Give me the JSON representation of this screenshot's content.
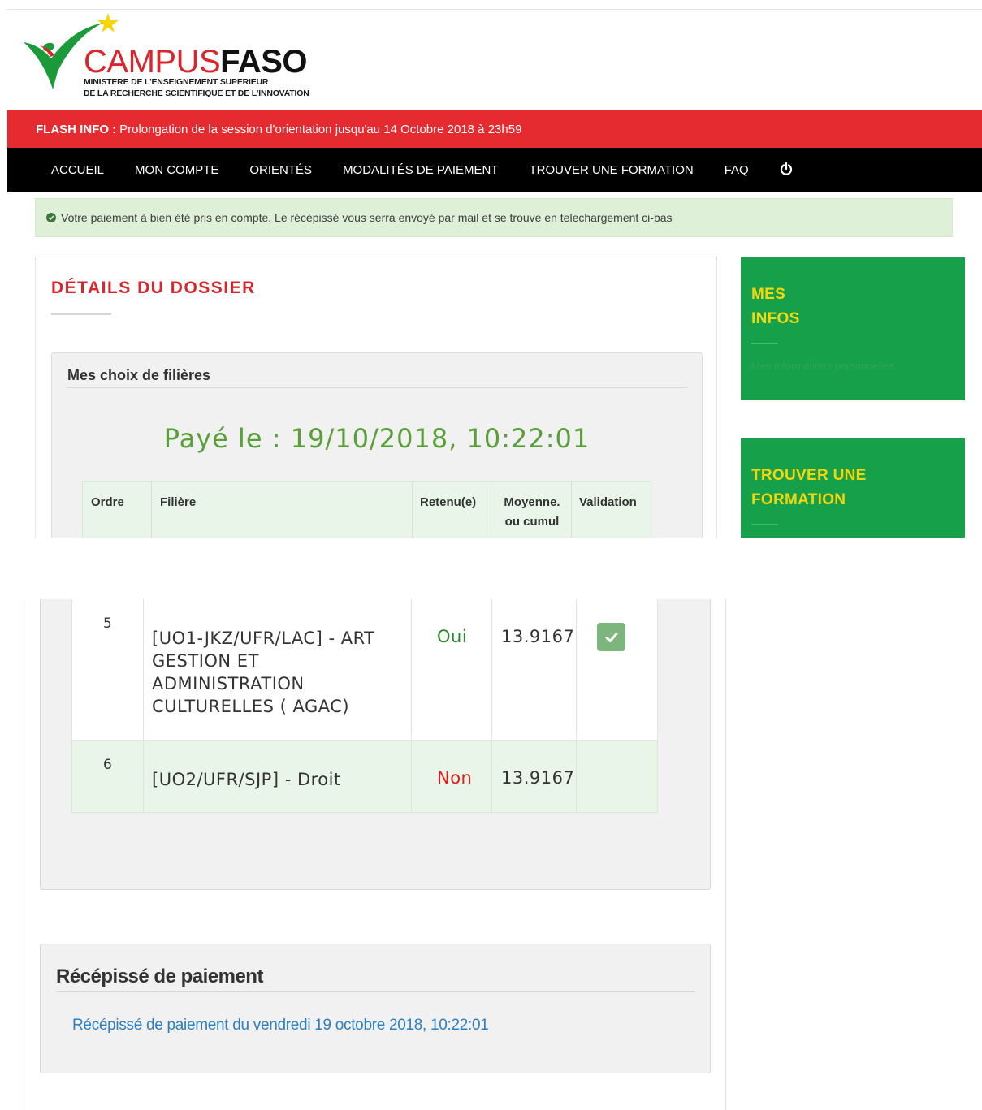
{
  "brand": {
    "name_part1": "CAMPUS",
    "name_part2": "FASO",
    "subtitle_line1": "MINISTERE DE L'ENSEIGNEMENT SUPERIEUR",
    "subtitle_line2": "DE LA RECHERCHE SCIENTIFIQUE ET DE L'INNOVATION",
    "colors": {
      "red": "#d9262c",
      "green": "#1b9a3a",
      "star": "#f5d60b"
    }
  },
  "flash": {
    "label": "FLASH INFO :",
    "text": "Prolongation de la session d'orientation jusqu'au 14 Octobre 2018 à 23h59",
    "color": "#e52b2f"
  },
  "nav": {
    "items": [
      "ACCUEIL",
      "MON COMPTE",
      "ORIENTÉS",
      "MODALITÉS DE PAIEMENT",
      "TROUVER UNE FORMATION",
      "FAQ"
    ],
    "power_icon": "power-icon"
  },
  "alert": {
    "text": "Votre paiement à bien été pris en compte. Le récépissé vous serra envoyé par mail et se trouve en telechargement ci-bas",
    "icon": "check-circle-icon"
  },
  "dossier": {
    "title": "DÉTAILS DU DOSSIER",
    "choices_title": "Mes choix de filières",
    "paid_text": "Payé le : 19/10/2018, 10:22:01",
    "table": {
      "headers": {
        "order": "Ordre",
        "filiere": "Filière",
        "retenu": "Retenu(e)",
        "moyenne_line1": "Moyenne.",
        "moyenne_line2": "ou cumul",
        "validation": "Validation"
      },
      "rows": [
        {
          "order": "5",
          "filiere": "[UO1-JKZ/UFR/LAC] - ART GESTION ET ADMINISTRATION CULTURELLES ( AGAC)",
          "retenu": "Oui",
          "moyenne": "13.9167",
          "validated": true
        },
        {
          "order": "6",
          "filiere": "[UO2/UFR/SJP] - Droit",
          "retenu": "Non",
          "moyenne": "13.9167",
          "validated": false
        }
      ]
    }
  },
  "sidebar": {
    "box1": {
      "title_line1": "MES",
      "title_line2": "INFOS",
      "link": "Mes informations personnelles"
    },
    "box2": {
      "title_line1": "TROUVER UNE",
      "title_line2": "FORMATION"
    }
  },
  "receipt": {
    "title": "Récépissé de paiement",
    "link": "Récépissé de paiement du vendredi 19 octobre 2018, 10:22:01"
  }
}
